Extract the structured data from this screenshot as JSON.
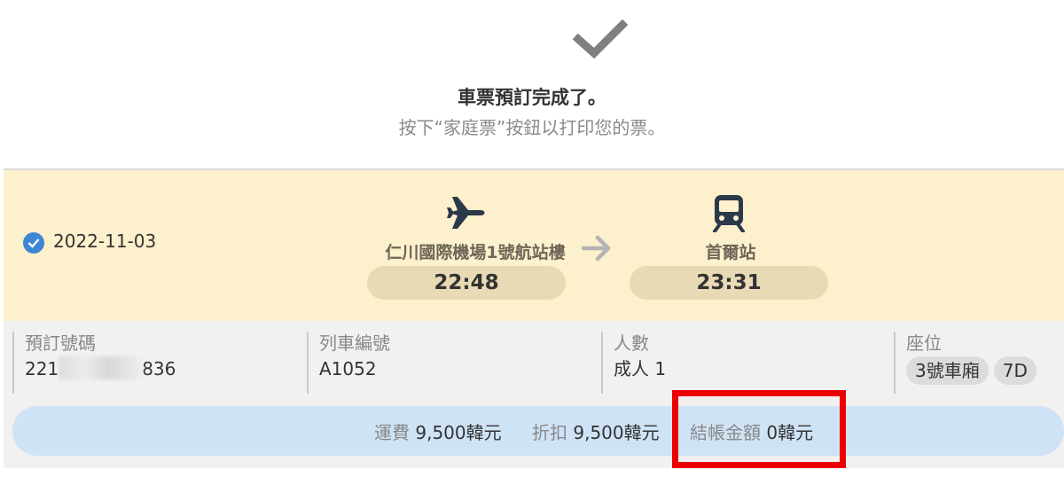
{
  "header": {
    "check_icon": "checkmark-icon",
    "title": "車票預訂完成了。",
    "subtitle": "按下“家庭票”按鈕以打印您的票。"
  },
  "journey": {
    "date": "2022-11-03",
    "date_icon": "check-circle-icon",
    "departure": {
      "icon": "airplane-icon",
      "station": "仁川國際機場1號航站樓",
      "time": "22:48"
    },
    "arrow_icon": "arrow-right-icon",
    "arrival": {
      "icon": "train-icon",
      "station": "首爾站",
      "time": "23:31"
    }
  },
  "details": {
    "booking_number": {
      "label": "預訂號碼",
      "value_prefix": "221",
      "value_suffix": "836"
    },
    "train_number": {
      "label": "列車編號",
      "value": "A1052"
    },
    "passengers": {
      "label": "人數",
      "value": "成人 1"
    },
    "seat": {
      "label": "座位",
      "car": "3號車廂",
      "seat": "7D"
    }
  },
  "fare": {
    "fare_label": "運費",
    "fare_value": "9,500韓元",
    "discount_label": "折扣",
    "discount_value": "9,500韓元",
    "total_label": "結帳金額",
    "total_value": "0韓元"
  },
  "colors": {
    "journey_bg": "#fdf0cc",
    "info_bg": "#f1f1f1",
    "fare_bar_bg": "#cfe3f6",
    "accent_blue": "#3d86d3",
    "highlight_red": "#ee0000"
  }
}
